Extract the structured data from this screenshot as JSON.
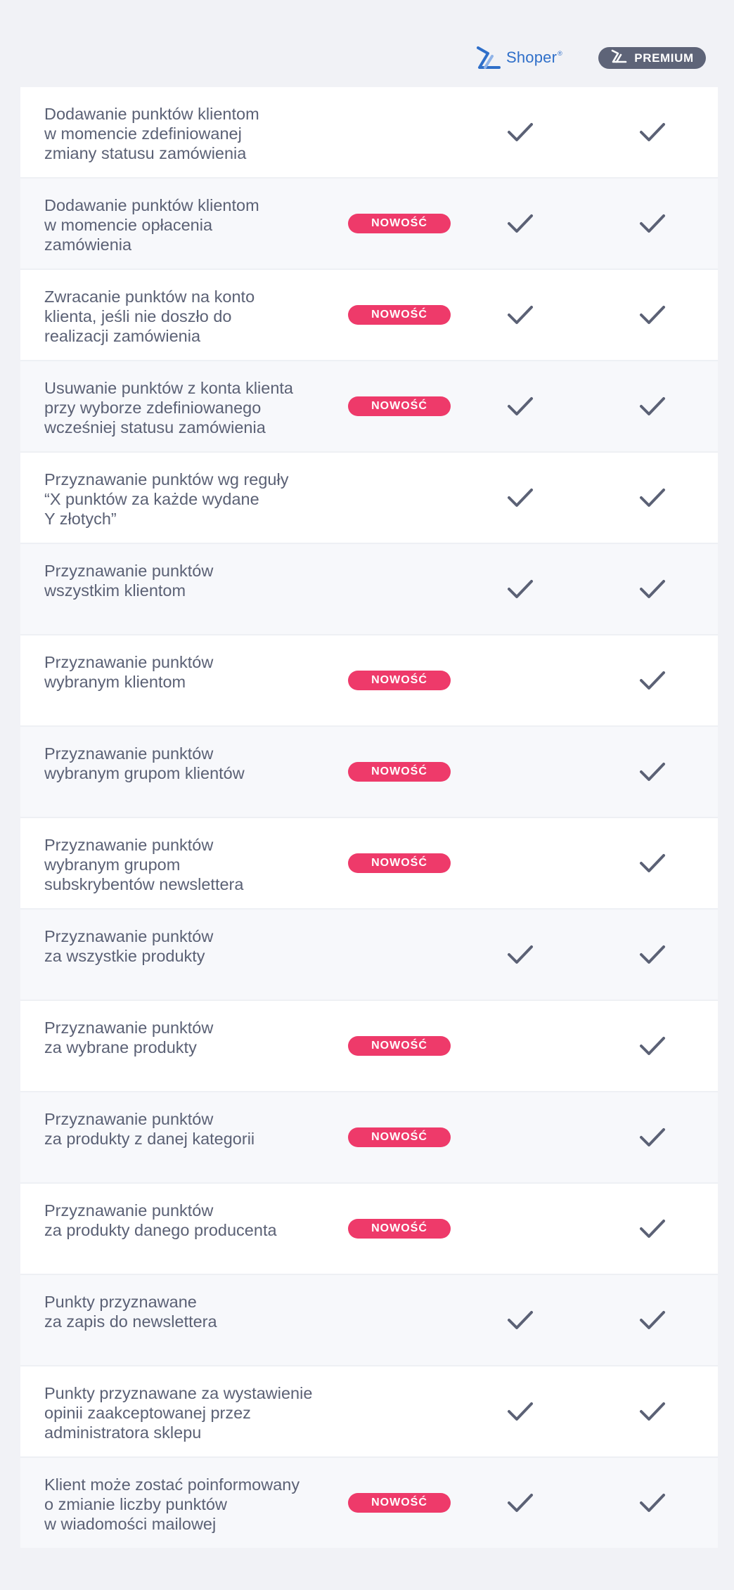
{
  "header": {
    "shoper_logo_text": "Shoper",
    "shoper_logo_reg": "®",
    "premium_label": "PREMIUM"
  },
  "badge_label": "NOWOŚĆ",
  "colors": {
    "badge": "#ee3a6a",
    "check": "#5b6175",
    "shoper_blue": "#2f6fc9",
    "premium_pill": "#5e6478"
  },
  "icons": {
    "check": "check-icon",
    "shoper_logo": "shoper-logo-icon",
    "premium_logo": "premium-logo-icon"
  },
  "rows": [
    {
      "feature": "Dodawanie punktów klientom\nw momencie zdefiniowanej\nzmiany statusu zamówienia",
      "badge": "",
      "shoper": true,
      "premium": true
    },
    {
      "feature": "Dodawanie punktów klientom\nw momencie opłacenia\nzamówienia",
      "badge": "NOWOŚĆ",
      "shoper": true,
      "premium": true
    },
    {
      "feature": "Zwracanie punktów na konto\nklienta, jeśli nie doszło do\nrealizacji zamówienia",
      "badge": "NOWOŚĆ",
      "shoper": true,
      "premium": true
    },
    {
      "feature": "Usuwanie punktów z konta klienta\nprzy wyborze zdefiniowanego\nwcześniej statusu zamówienia",
      "badge": "NOWOŚĆ",
      "shoper": true,
      "premium": true
    },
    {
      "feature": "Przyznawanie punktów wg reguły\n“X punktów za każde wydane\nY złotych”",
      "badge": "",
      "shoper": true,
      "premium": true
    },
    {
      "feature": "Przyznawanie punktów\nwszystkim klientom",
      "badge": "",
      "shoper": true,
      "premium": true
    },
    {
      "feature": "Przyznawanie punktów\nwybranym klientom",
      "badge": "NOWOŚĆ",
      "shoper": false,
      "premium": true
    },
    {
      "feature": "Przyznawanie punktów\nwybranym grupom klientów",
      "badge": "NOWOŚĆ",
      "shoper": false,
      "premium": true
    },
    {
      "feature": "Przyznawanie punktów\nwybranym grupom\nsubskrybentów newslettera",
      "badge": "NOWOŚĆ",
      "shoper": false,
      "premium": true
    },
    {
      "feature": "Przyznawanie punktów\nza wszystkie produkty",
      "badge": "",
      "shoper": true,
      "premium": true
    },
    {
      "feature": "Przyznawanie punktów\nza wybrane produkty",
      "badge": "NOWOŚĆ",
      "shoper": false,
      "premium": true
    },
    {
      "feature": "Przyznawanie punktów\nza produkty z danej kategorii",
      "badge": "NOWOŚĆ",
      "shoper": false,
      "premium": true
    },
    {
      "feature": "Przyznawanie punktów\nza produkty danego producenta",
      "badge": "NOWOŚĆ",
      "shoper": false,
      "premium": true
    },
    {
      "feature": "Punkty przyznawane\nza zapis do newslettera",
      "badge": "",
      "shoper": true,
      "premium": true
    },
    {
      "feature": "Punkty przyznawane za wystawienie\nopinii zaakceptowanej przez\nadministratora sklepu",
      "badge": "",
      "shoper": true,
      "premium": true
    },
    {
      "feature": "Klient może zostać poinformowany\no zmianie liczby punktów\nw wiadomości mailowej",
      "badge": "NOWOŚĆ",
      "shoper": true,
      "premium": true
    }
  ]
}
